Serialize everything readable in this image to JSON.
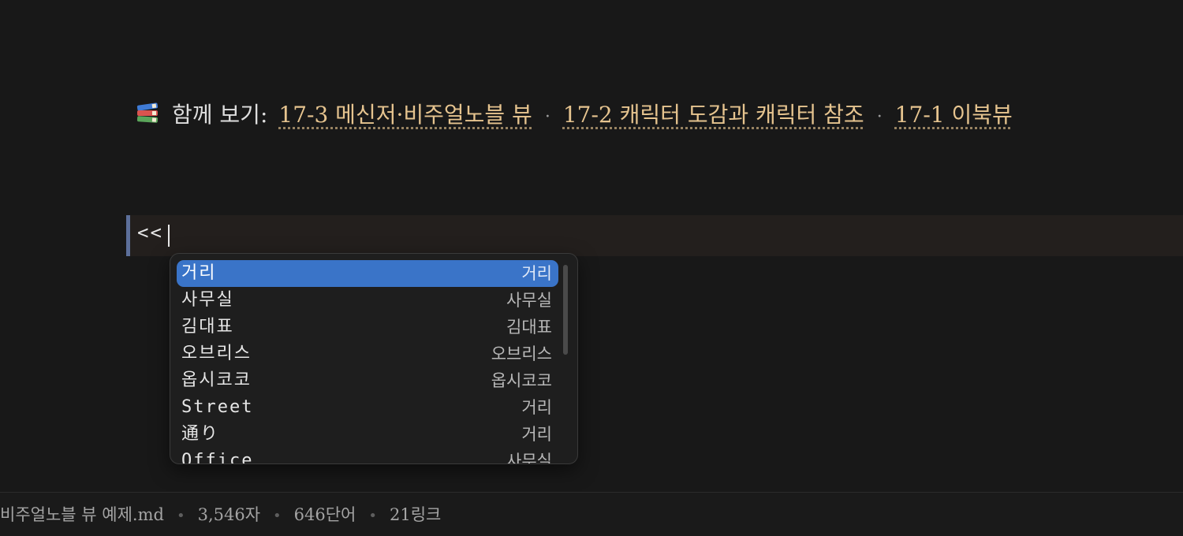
{
  "see_also": {
    "label": "함께 보기:",
    "links": [
      "17-3 메신저·비주얼노블 뷰",
      "17-2 캐릭터 도감과 캐릭터 참조",
      "17-1 이북뷰"
    ],
    "separator": "·"
  },
  "editor": {
    "current_line": "<<"
  },
  "autocomplete": {
    "items": [
      {
        "name": "거리",
        "alias": "거리",
        "selected": true
      },
      {
        "name": "사무실",
        "alias": "사무실",
        "selected": false
      },
      {
        "name": "김대표",
        "alias": "김대표",
        "selected": false
      },
      {
        "name": "오브리스",
        "alias": "오브리스",
        "selected": false
      },
      {
        "name": "옵시코코",
        "alias": "옵시코코",
        "selected": false
      },
      {
        "name": "Street",
        "alias": "거리",
        "selected": false
      },
      {
        "name": "通り",
        "alias": "거리",
        "selected": false
      },
      {
        "name": "Office",
        "alias": "사무실",
        "selected": false
      }
    ]
  },
  "statusbar": {
    "filename": "비주얼노블 뷰 예제.md",
    "chars": "3,546자",
    "words": "646단어",
    "links": "21링크"
  },
  "colors": {
    "background": "#181818",
    "accent_selection": "#3a74c8",
    "link": "#e6c48f",
    "active_line_border": "#5c6f9a"
  },
  "icons": {
    "see_also": "books-emoji-icon"
  }
}
